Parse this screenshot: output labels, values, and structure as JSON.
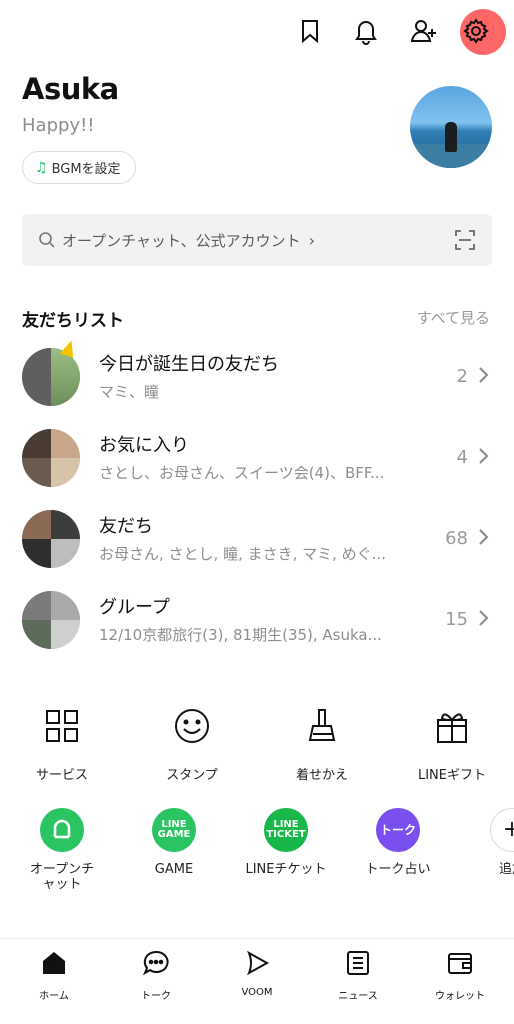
{
  "profile": {
    "name": "Asuka",
    "status": "Happy!!",
    "bgm_label": "BGMを設定"
  },
  "search": {
    "placeholder": "オープンチャット、公式アカウント"
  },
  "friends": {
    "title": "友だちリスト",
    "see_all": "すべて見る",
    "rows": [
      {
        "title": "今日が誕生日の友だち",
        "sub": "マミ、瞳",
        "count": "2"
      },
      {
        "title": "お気に入り",
        "sub": "さとし、お母さん、スイーツ会(4)、BFF...",
        "count": "4"
      },
      {
        "title": "友だち",
        "sub": "お母さん, さとし, 瞳, まさき, マミ, めぐ...",
        "count": "68"
      },
      {
        "title": "グループ",
        "sub": "12/10京都旅行(3), 81期生(35), Asuka...",
        "count": "15"
      }
    ]
  },
  "services": [
    {
      "label": "サービス",
      "icon": "grid-icon"
    },
    {
      "label": "スタンプ",
      "icon": "smiley-icon"
    },
    {
      "label": "着せかえ",
      "icon": "brush-icon"
    },
    {
      "label": "LINEギフト",
      "icon": "gift-icon"
    }
  ],
  "apps": [
    {
      "label": "オープンチャット",
      "icon": "openchat-icon",
      "color": "#2bc462"
    },
    {
      "label": "GAME",
      "icon": "line-game-icon",
      "badge": "LINE GAME",
      "color": "#2bc462"
    },
    {
      "label": "LINEチケット",
      "icon": "line-ticket-icon",
      "badge": "LINE TICKET",
      "color": "#17b749"
    },
    {
      "label": "トーク占い",
      "icon": "talk-fortune-icon",
      "badge": "トーク",
      "color": "#7a4ff0"
    },
    {
      "label": "追加",
      "icon": "add-icon"
    }
  ],
  "nav": {
    "home": "ホーム",
    "talk": "トーク",
    "voom": "VOOM",
    "news": "ニュース",
    "wallet": "ウォレット"
  },
  "colors": {
    "accent_green": "#27c46a",
    "settings_highlight": "#ff5a5a"
  }
}
